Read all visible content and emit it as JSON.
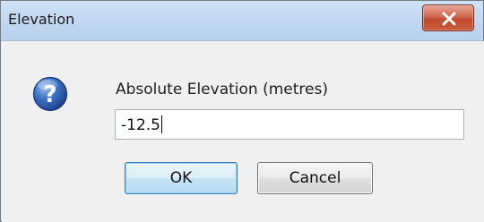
{
  "window": {
    "title": "Elevation"
  },
  "dialog": {
    "icon": "question-icon",
    "prompt": "Absolute Elevation (metres)",
    "input_value": "-12.5"
  },
  "buttons": {
    "ok_label": "OK",
    "cancel_label": "Cancel"
  },
  "colors": {
    "titlebar": "#c3d9f1",
    "close_button": "#c24a2f",
    "ok_border": "#3c7fb1",
    "dialog_background": "#f0f0f0",
    "question_icon": "#2c5aa0"
  }
}
